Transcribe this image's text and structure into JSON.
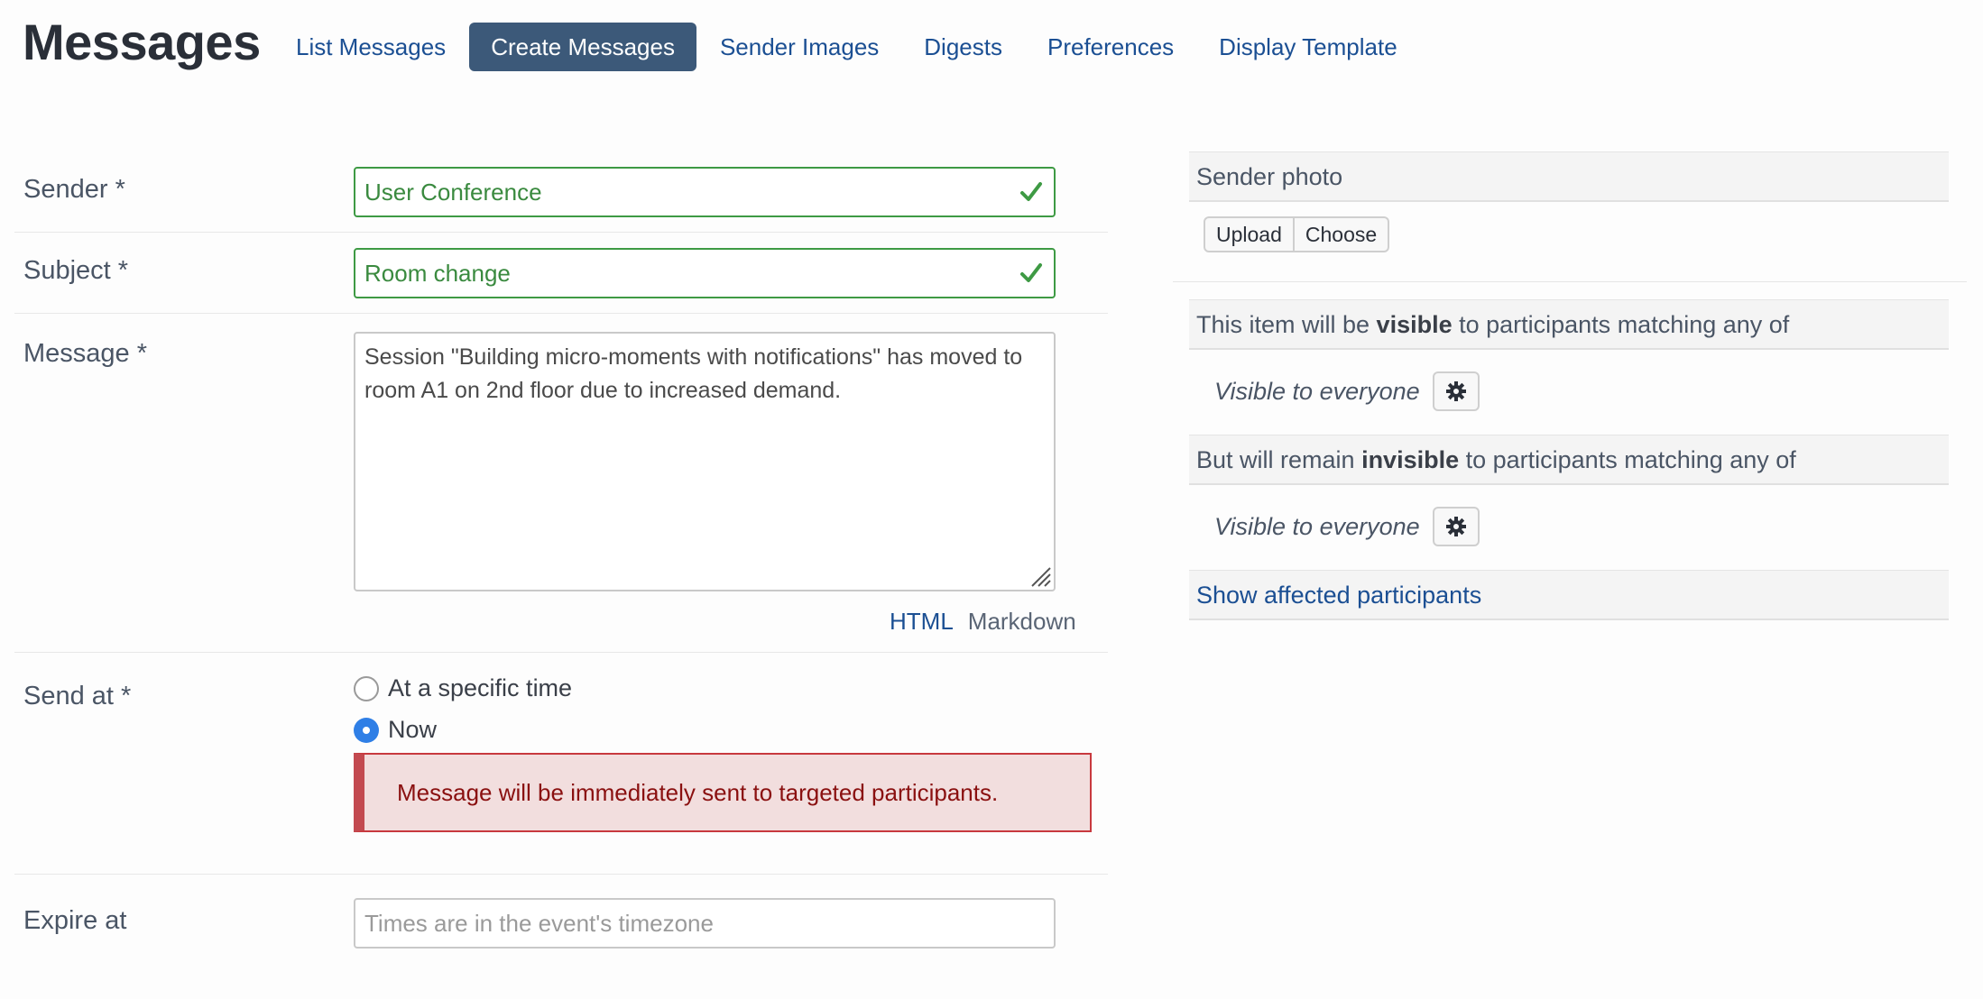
{
  "header": {
    "title": "Messages",
    "tabs": [
      {
        "label": "List Messages",
        "active": false
      },
      {
        "label": "Create Messages",
        "active": true
      },
      {
        "label": "Sender Images",
        "active": false
      },
      {
        "label": "Digests",
        "active": false
      },
      {
        "label": "Preferences",
        "active": false
      },
      {
        "label": "Display Template",
        "active": false
      }
    ]
  },
  "form": {
    "sender": {
      "label": "Sender *",
      "value": "User Conference"
    },
    "subject": {
      "label": "Subject *",
      "value": "Room change"
    },
    "message": {
      "label": "Message *",
      "value": "Session \"Building micro-moments with notifications\" has moved to room A1 on 2nd floor due to increased demand.",
      "format_html": "HTML",
      "format_markdown": "Markdown"
    },
    "send_at": {
      "label": "Send at *",
      "options": [
        {
          "label": "At a specific time",
          "checked": false
        },
        {
          "label": "Now",
          "checked": true
        }
      ],
      "alert": "Message will be immediately sent to targeted participants."
    },
    "expire_at": {
      "label": "Expire at",
      "placeholder": "Times are in the event's timezone"
    }
  },
  "sidebar": {
    "sender_photo": {
      "title": "Sender photo",
      "upload": "Upload",
      "choose": "Choose"
    },
    "visible": {
      "prefix": "This item will be ",
      "keyword": "visible",
      "suffix": " to participants matching any of",
      "value": "Visible to everyone"
    },
    "invisible": {
      "prefix": "But will remain ",
      "keyword": "invisible",
      "suffix": " to participants matching any of",
      "value": "Visible to everyone"
    },
    "show_affected": "Show affected participants"
  },
  "colors": {
    "accent": "#3c5979",
    "link": "#1b4f93",
    "valid": "#3e9a44",
    "alert_bg": "#f2dede",
    "alert_text": "#8a1010",
    "radio_checked": "#2f7fe6"
  }
}
